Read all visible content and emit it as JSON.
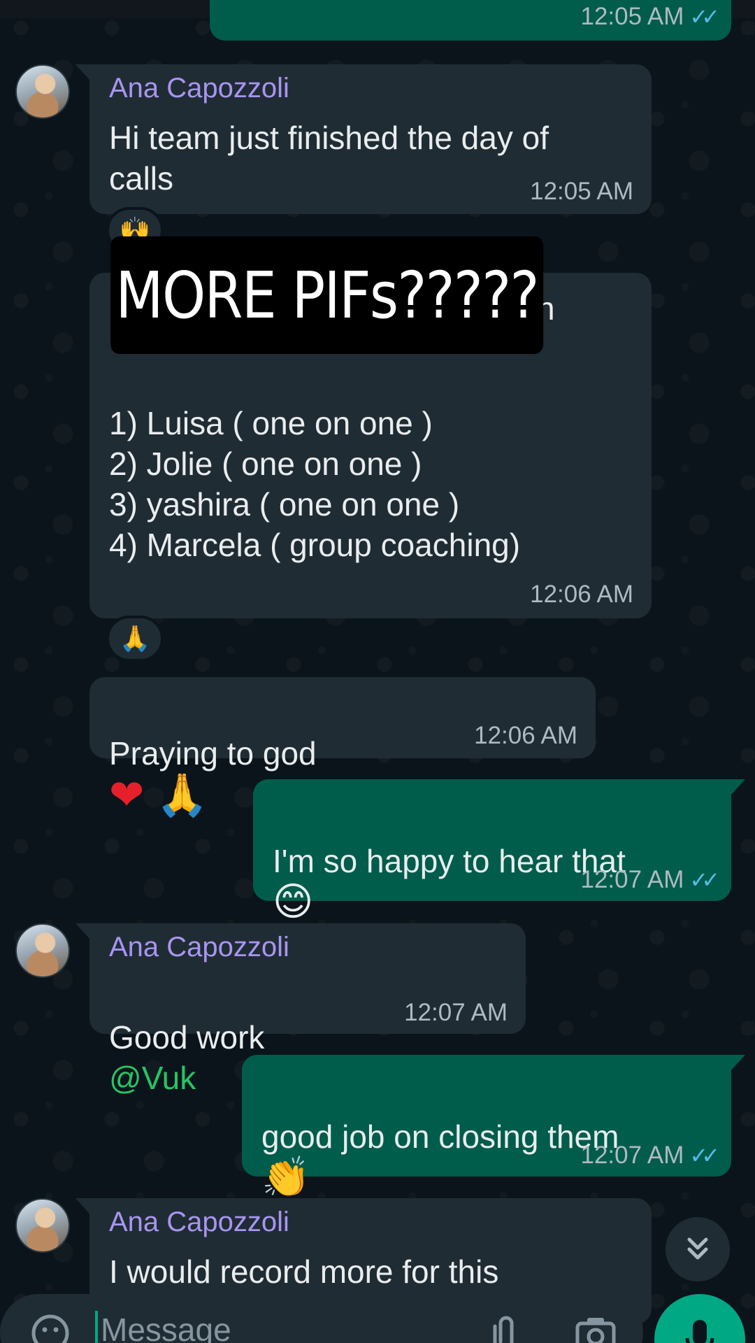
{
  "messages": [
    {
      "time": "12:05 AM",
      "ticks": "✓✓"
    },
    {
      "sender": "Ana Capozzoli",
      "text": "Hi team just finished the day of\ncalls",
      "time": "12:05 AM"
    },
    {
      "text_partial_right": "n",
      "list": "1) Luisa ( one on one )\n2) Jolie ( one on one )\n3) yashira ( one on one )\n4) Marcela ( group coaching)",
      "time": "12:06 AM",
      "reaction": "🙌"
    },
    {
      "text": "Praying to god",
      "emoji": "❤ 🙏",
      "time": "12:06 AM",
      "reaction": "🙏"
    },
    {
      "text": "I'm so happy to hear that",
      "emoji": "😊",
      "time": "12:07 AM",
      "ticks": "✓✓"
    },
    {
      "sender": "Ana Capozzoli",
      "text": "Good work",
      "mention": "@Vuk",
      "time": "12:07 AM"
    },
    {
      "text": "good job on closing them",
      "emoji": "👏",
      "time": "12:07 AM",
      "ticks": "✓✓"
    },
    {
      "sender": "Ana Capozzoli",
      "text": "I would record more for this"
    }
  ],
  "overlay": {
    "text": "MORE PIFs?????"
  },
  "composer": {
    "placeholder": "Message"
  },
  "icons": {
    "scroll": "chevron-double-down-icon",
    "mic": "mic-icon",
    "attach": "paperclip-icon",
    "camera": "camera-icon",
    "emoji": "emoji-icon"
  }
}
